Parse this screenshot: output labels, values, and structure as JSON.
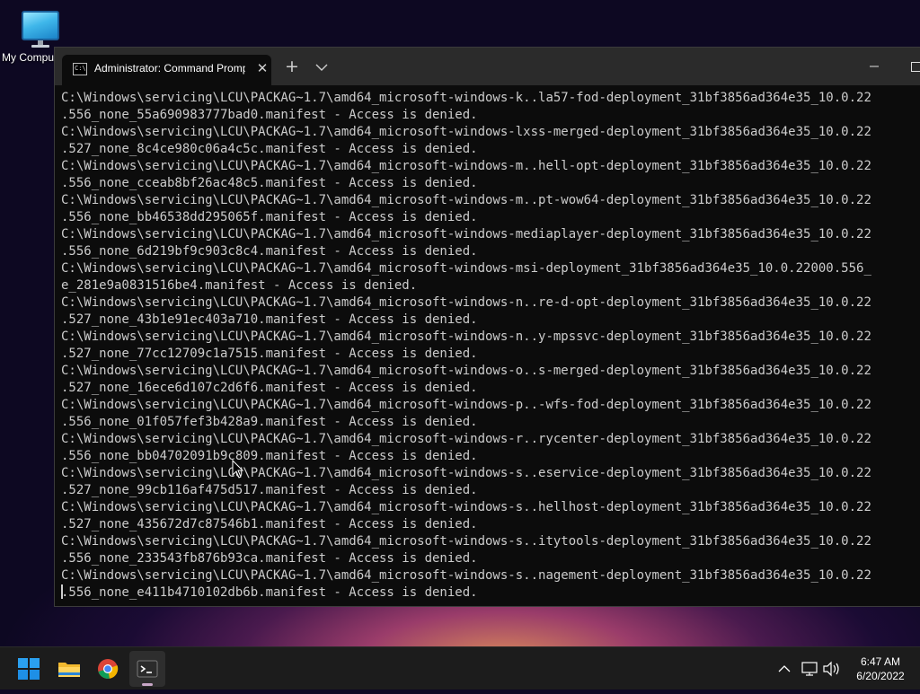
{
  "desktop": {
    "icons": [
      {
        "label": "My Compu",
        "icon": "computer-icon"
      }
    ]
  },
  "window": {
    "tab": {
      "title": "Administrator: Command Promp",
      "icon": "cmd-icon"
    },
    "controls": [
      "close-tab-icon",
      "new-tab-icon",
      "tab-dropdown-icon",
      "minimize-icon",
      "maximize-icon"
    ]
  },
  "terminal": {
    "lines": [
      "C:\\Windows\\servicing\\LCU\\PACKAG~1.7\\amd64_microsoft-windows-k..la57-fod-deployment_31bf3856ad364e35_10.0.22",
      ".556_none_55a690983777bad0.manifest - Access is denied.",
      "C:\\Windows\\servicing\\LCU\\PACKAG~1.7\\amd64_microsoft-windows-lxss-merged-deployment_31bf3856ad364e35_10.0.22",
      ".527_none_8c4ce980c06a4c5c.manifest - Access is denied.",
      "C:\\Windows\\servicing\\LCU\\PACKAG~1.7\\amd64_microsoft-windows-m..hell-opt-deployment_31bf3856ad364e35_10.0.22",
      ".556_none_cceab8bf26ac48c5.manifest - Access is denied.",
      "C:\\Windows\\servicing\\LCU\\PACKAG~1.7\\amd64_microsoft-windows-m..pt-wow64-deployment_31bf3856ad364e35_10.0.22",
      ".556_none_bb46538dd295065f.manifest - Access is denied.",
      "C:\\Windows\\servicing\\LCU\\PACKAG~1.7\\amd64_microsoft-windows-mediaplayer-deployment_31bf3856ad364e35_10.0.22",
      ".556_none_6d219bf9c903c8c4.manifest - Access is denied.",
      "C:\\Windows\\servicing\\LCU\\PACKAG~1.7\\amd64_microsoft-windows-msi-deployment_31bf3856ad364e35_10.0.22000.556_",
      "e_281e9a0831516be4.manifest - Access is denied.",
      "C:\\Windows\\servicing\\LCU\\PACKAG~1.7\\amd64_microsoft-windows-n..re-d-opt-deployment_31bf3856ad364e35_10.0.22",
      ".527_none_43b1e91ec403a710.manifest - Access is denied.",
      "C:\\Windows\\servicing\\LCU\\PACKAG~1.7\\amd64_microsoft-windows-n..y-mpssvc-deployment_31bf3856ad364e35_10.0.22",
      ".527_none_77cc12709c1a7515.manifest - Access is denied.",
      "C:\\Windows\\servicing\\LCU\\PACKAG~1.7\\amd64_microsoft-windows-o..s-merged-deployment_31bf3856ad364e35_10.0.22",
      ".527_none_16ece6d107c2d6f6.manifest - Access is denied.",
      "C:\\Windows\\servicing\\LCU\\PACKAG~1.7\\amd64_microsoft-windows-p..-wfs-fod-deployment_31bf3856ad364e35_10.0.22",
      ".556_none_01f057fef3b428a9.manifest - Access is denied.",
      "C:\\Windows\\servicing\\LCU\\PACKAG~1.7\\amd64_microsoft-windows-r..rycenter-deployment_31bf3856ad364e35_10.0.22",
      ".556_none_bb04702091b9c809.manifest - Access is denied.",
      "C:\\Windows\\servicing\\LCU\\PACKAG~1.7\\amd64_microsoft-windows-s..eservice-deployment_31bf3856ad364e35_10.0.22",
      ".527_none_99cb116af475d517.manifest - Access is denied.",
      "C:\\Windows\\servicing\\LCU\\PACKAG~1.7\\amd64_microsoft-windows-s..hellhost-deployment_31bf3856ad364e35_10.0.22",
      ".527_none_435672d7c87546b1.manifest - Access is denied.",
      "C:\\Windows\\servicing\\LCU\\PACKAG~1.7\\amd64_microsoft-windows-s..itytools-deployment_31bf3856ad364e35_10.0.22",
      ".556_none_233543fb876b93ca.manifest - Access is denied.",
      "C:\\Windows\\servicing\\LCU\\PACKAG~1.7\\amd64_microsoft-windows-s..nagement-deployment_31bf3856ad364e35_10.0.22",
      ".556_none_e411b4710102db6b.manifest - Access is denied."
    ]
  },
  "taskbar": {
    "items": [
      {
        "name": "start-button",
        "icon": "windows-logo-icon"
      },
      {
        "name": "file-explorer-button",
        "icon": "folder-icon"
      },
      {
        "name": "chrome-button",
        "icon": "chrome-icon"
      },
      {
        "name": "terminal-button",
        "icon": "terminal-icon",
        "active": true
      }
    ],
    "tray": {
      "icons": [
        "chevron-up-icon",
        "network-icon",
        "volume-icon"
      ],
      "time": "6:47 AM",
      "date": "6/20/2022"
    }
  },
  "colors": {
    "terminal_bg": "#0c0c0c",
    "terminal_text": "#cccccc",
    "titlebar_bg": "#2b2b2b",
    "taskbar_bg": "#1c1c1c",
    "windows_blue": "#1e90ff"
  }
}
